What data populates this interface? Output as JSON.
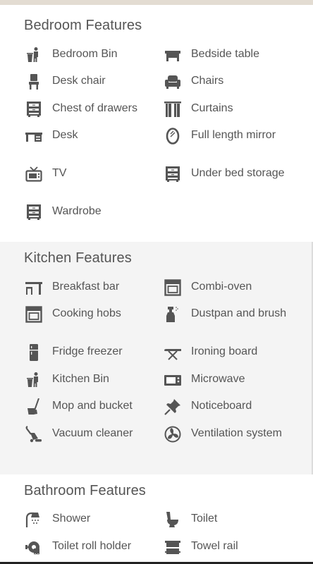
{
  "colors": {
    "text": "#555555",
    "icon": "#555555",
    "kitchen_bg": "#f4f4f4",
    "top_strip": "#e3dcd2"
  },
  "sections": [
    {
      "title": "Bedroom Features",
      "features": [
        {
          "label": "Bedroom Bin",
          "icon": "bin-person-icon"
        },
        {
          "label": "Bedside table",
          "icon": "bedside-table-icon"
        },
        {
          "label": "Desk chair",
          "icon": "desk-chair-icon"
        },
        {
          "label": "Chairs",
          "icon": "armchair-icon"
        },
        {
          "label": "Chest of drawers",
          "icon": "drawers-icon"
        },
        {
          "label": "Curtains",
          "icon": "curtains-icon"
        },
        {
          "label": "Desk",
          "icon": "desk-icon"
        },
        {
          "label": "Full length mirror",
          "icon": "mirror-icon"
        },
        {
          "label": "TV",
          "icon": "tv-icon"
        },
        {
          "label": "Under bed storage",
          "icon": "drawers-icon"
        },
        {
          "label": "Wardrobe",
          "icon": "drawers-icon"
        }
      ]
    },
    {
      "title": "Kitchen Features",
      "features": [
        {
          "label": "Breakfast bar",
          "icon": "breakfast-bar-icon"
        },
        {
          "label": "Combi-oven",
          "icon": "oven-icon"
        },
        {
          "label": "Cooking hobs",
          "icon": "oven-icon"
        },
        {
          "label": "Dustpan and brush",
          "icon": "spray-bottle-icon"
        },
        {
          "label": "Fridge freezer",
          "icon": "fridge-icon"
        },
        {
          "label": "Ironing board",
          "icon": "ironing-board-icon"
        },
        {
          "label": "Kitchen Bin",
          "icon": "bin-person-icon"
        },
        {
          "label": "Microwave",
          "icon": "microwave-icon"
        },
        {
          "label": "Mop and bucket",
          "icon": "mop-bucket-icon"
        },
        {
          "label": "Noticeboard",
          "icon": "pushpin-icon"
        },
        {
          "label": "Vacuum cleaner",
          "icon": "vacuum-icon"
        },
        {
          "label": "Ventilation system",
          "icon": "fan-icon"
        }
      ]
    },
    {
      "title": "Bathroom Features",
      "features": [
        {
          "label": "Shower",
          "icon": "shower-icon"
        },
        {
          "label": "Toilet",
          "icon": "toilet-icon"
        },
        {
          "label": "Toilet roll holder",
          "icon": "toilet-roll-icon"
        },
        {
          "label": "Towel rail",
          "icon": "towel-rail-icon"
        }
      ]
    }
  ]
}
